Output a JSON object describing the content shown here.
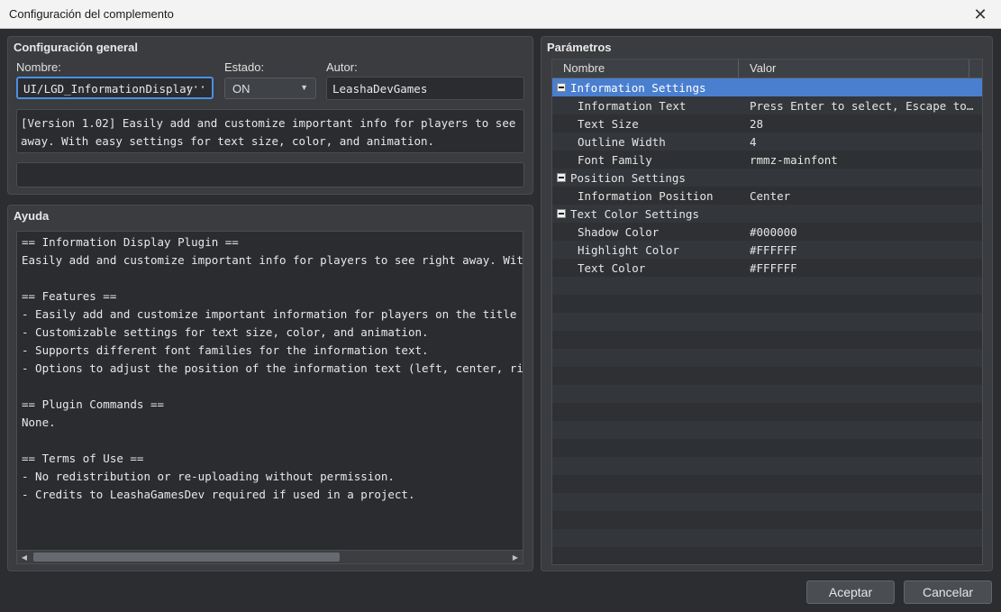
{
  "window": {
    "title": "Configuración del complemento"
  },
  "general": {
    "title": "Configuración general",
    "name_label": "Nombre:",
    "name_value": "UI/LGD_InformationDisplay",
    "browse_label": "···",
    "status_label": "Estado:",
    "status_value": "ON",
    "author_label": "Autor:",
    "author_value": "LeashaDevGames",
    "description": "[Version 1.02] Easily add and customize important info for players to see right\naway. With easy settings for text size, color, and animation.",
    "extra": ""
  },
  "help": {
    "title": "Ayuda",
    "lines": [
      "== Information Display Plugin ==",
      "Easily add and customize important info for players to see right away. With eas",
      "",
      "== Features ==",
      "- Easily add and customize important information for players on the title scree",
      "- Customizable settings for text size, color, and animation.",
      "- Supports different font families for the information text.",
      "- Options to adjust the position of the information text (left, center, right).",
      "",
      "== Plugin Commands ==",
      "None.",
      "",
      "== Terms of Use ==",
      "- No redistribution or re-uploading without permission.",
      "- Credits to LeashaGamesDev required if used in a project."
    ]
  },
  "params": {
    "title": "Parámetros",
    "col_name": "Nombre",
    "col_value": "Valor",
    "rows": [
      {
        "name": "Information Settings",
        "value": "",
        "group": true,
        "selected": true
      },
      {
        "name": "Information Text",
        "value": "Press Enter to select, Escape to…",
        "group": false
      },
      {
        "name": "Text Size",
        "value": "28",
        "group": false
      },
      {
        "name": "Outline Width",
        "value": "4",
        "group": false
      },
      {
        "name": "Font Family",
        "value": "rmmz-mainfont",
        "group": false
      },
      {
        "name": "Position Settings",
        "value": "",
        "group": true
      },
      {
        "name": "Information Position",
        "value": "Center",
        "group": false
      },
      {
        "name": "Text Color Settings",
        "value": "",
        "group": true
      },
      {
        "name": "Shadow Color",
        "value": "#000000",
        "group": false
      },
      {
        "name": "Highlight Color",
        "value": "#FFFFFF",
        "group": false
      },
      {
        "name": "Text Color",
        "value": "#FFFFFF",
        "group": false
      }
    ]
  },
  "buttons": {
    "accept": "Aceptar",
    "cancel": "Cancelar"
  },
  "icons": {
    "close": "close-icon",
    "dropdown": "chevron-down-icon",
    "collapse": "minus-icon"
  },
  "colors": {
    "selection": "#4a7fd0",
    "focus": "#4a90e2"
  }
}
